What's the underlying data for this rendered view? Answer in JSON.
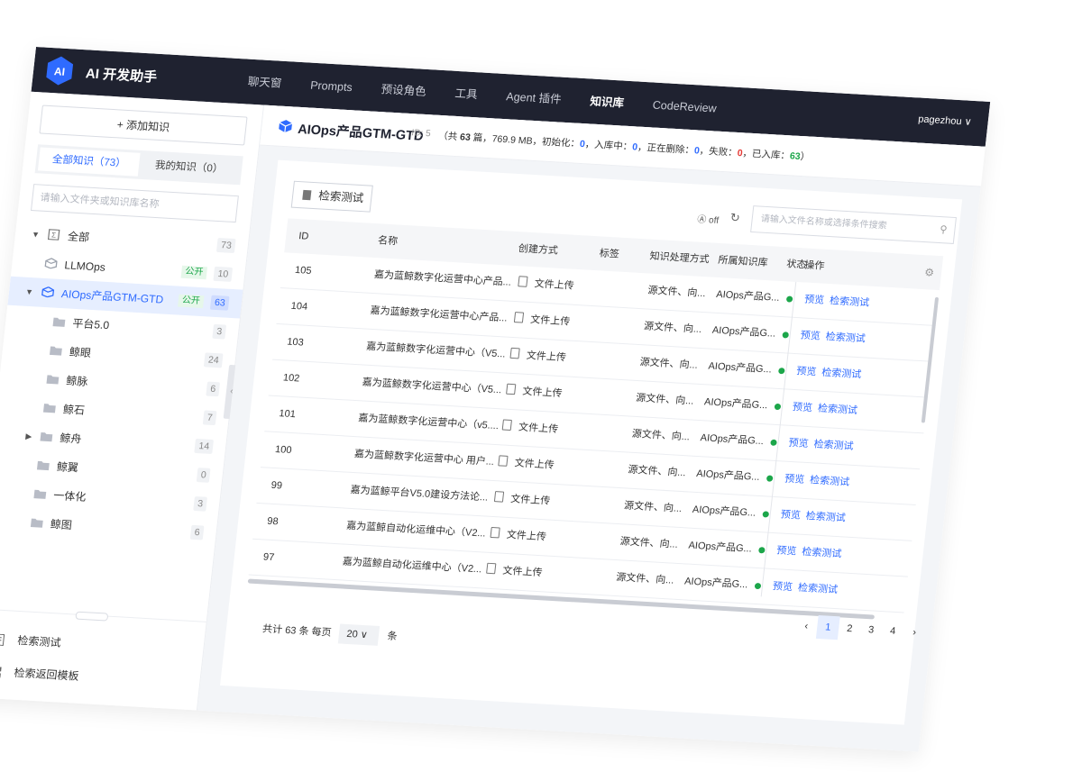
{
  "app": {
    "title": "AI 开发助手",
    "logo_text": "AI",
    "colors": {
      "nav_bg": "#1f2230",
      "accent": "#2f6bff",
      "success": "#1ca64a",
      "danger": "#e53935"
    }
  },
  "nav": {
    "items": [
      "聊天窗",
      "Prompts",
      "预设角色",
      "工具",
      "Agent 插件",
      "知识库",
      "CodeReview"
    ],
    "active": "知识库",
    "user": "pagezhou ∨"
  },
  "sidebar": {
    "add_label": "+ 添加知识",
    "tabs": [
      {
        "label": "全部知识（73）",
        "active": true
      },
      {
        "label": "我的知识（0）",
        "active": false
      }
    ],
    "search_placeholder": "请输入文件夹或知识库名称",
    "tree": [
      {
        "label": "全部",
        "count": "73",
        "icon": "all-icon",
        "caret": "▼"
      },
      {
        "label": "LLMOps",
        "count": "10",
        "public": "公开",
        "icon": "box-icon"
      },
      {
        "label": "AIOps产品GTM-GTD",
        "count": "63",
        "public": "公开",
        "icon": "box-icon",
        "caret": "▼",
        "selected": true
      },
      {
        "label": "平台5.0",
        "count": "3",
        "icon": "folder-icon"
      },
      {
        "label": "鲸眼",
        "count": "24",
        "icon": "folder-icon"
      },
      {
        "label": "鲸脉",
        "count": "6",
        "icon": "folder-icon"
      },
      {
        "label": "鲸石",
        "count": "7",
        "icon": "folder-icon"
      },
      {
        "label": "鲸舟",
        "count": "14",
        "icon": "folder-icon",
        "caret": "▶"
      },
      {
        "label": "鲸翼",
        "count": "0",
        "icon": "folder-icon"
      },
      {
        "label": "一体化",
        "count": "3",
        "icon": "folder-icon"
      },
      {
        "label": "鲸图",
        "count": "6",
        "icon": "folder-icon"
      }
    ],
    "footer": [
      {
        "label": "检索测试",
        "icon": "file-search-icon"
      },
      {
        "label": "检索返回模板",
        "icon": "template-icon"
      }
    ]
  },
  "kb": {
    "title": "AIOps产品GTM-GTD",
    "id_text": "ID: 5",
    "stats": {
      "prefix": "（共 ",
      "total": "63",
      "mid": " 篇，769.9 MB，初始化：",
      "init": "0",
      "in_label": "，入库中：",
      "in_progress": "0",
      "del_label": "，正在删除：",
      "deleting": "0",
      "fail_label": "，失败：",
      "failed": "0",
      "done_label": "，已入库：",
      "done": "63",
      "suffix": "）"
    }
  },
  "toolbar": {
    "test_button": "检索测试",
    "toggle_label": "off",
    "search_placeholder": "请输入文件名称或选择条件搜索"
  },
  "table": {
    "headers": [
      "ID",
      "名称",
      "创建方式",
      "标签",
      "知识处理方式",
      "所属知识库",
      "状态",
      "操作"
    ],
    "rows": [
      {
        "id": "105",
        "name": "嘉为蓝鲸数字化运营中心产品...",
        "method": "文件上传",
        "tag": "",
        "process": "源文件、向...",
        "kb": "AIOps产品G...",
        "ops": [
          "预览",
          "检索测试"
        ]
      },
      {
        "id": "104",
        "name": "嘉为蓝鲸数字化运营中心产品...",
        "method": "文件上传",
        "tag": "",
        "process": "源文件、向...",
        "kb": "AIOps产品G...",
        "ops": [
          "预览",
          "检索测试"
        ]
      },
      {
        "id": "103",
        "name": "嘉为蓝鲸数字化运营中心（V5...",
        "method": "文件上传",
        "tag": "",
        "process": "源文件、向...",
        "kb": "AIOps产品G...",
        "ops": [
          "预览",
          "检索测试"
        ]
      },
      {
        "id": "102",
        "name": "嘉为蓝鲸数字化运营中心（V5...",
        "method": "文件上传",
        "tag": "",
        "process": "源文件、向...",
        "kb": "AIOps产品G...",
        "ops": [
          "预览",
          "检索测试"
        ]
      },
      {
        "id": "101",
        "name": "嘉为蓝鲸数字化运营中心（v5....",
        "method": "文件上传",
        "tag": "",
        "process": "源文件、向...",
        "kb": "AIOps产品G...",
        "ops": [
          "预览",
          "检索测试"
        ]
      },
      {
        "id": "100",
        "name": "嘉为蓝鲸数字化运营中心 用户...",
        "method": "文件上传",
        "tag": "",
        "process": "源文件、向...",
        "kb": "AIOps产品G...",
        "ops": [
          "预览",
          "检索测试"
        ]
      },
      {
        "id": "99",
        "name": "嘉为蓝鲸平台V5.0建设方法论...",
        "method": "文件上传",
        "tag": "",
        "process": "源文件、向...",
        "kb": "AIOps产品G...",
        "ops": [
          "预览",
          "检索测试"
        ]
      },
      {
        "id": "98",
        "name": "嘉为蓝鲸自动化运维中心（V2...",
        "method": "文件上传",
        "tag": "",
        "process": "源文件、向...",
        "kb": "AIOps产品G...",
        "ops": [
          "预览",
          "检索测试"
        ]
      },
      {
        "id": "97",
        "name": "嘉为蓝鲸自动化运维中心（V2...",
        "method": "文件上传",
        "tag": "",
        "process": "源文件、向...",
        "kb": "AIOps产品G...",
        "ops": [
          "预览",
          "检索测试"
        ]
      }
    ]
  },
  "pagination": {
    "total_text": "共计 63 条",
    "per_page_label": "每页",
    "per_page_value": "20",
    "per_page_suffix": "条",
    "prev": "‹",
    "next": "›",
    "pages": [
      "1",
      "2",
      "3",
      "4"
    ],
    "current": "1"
  }
}
